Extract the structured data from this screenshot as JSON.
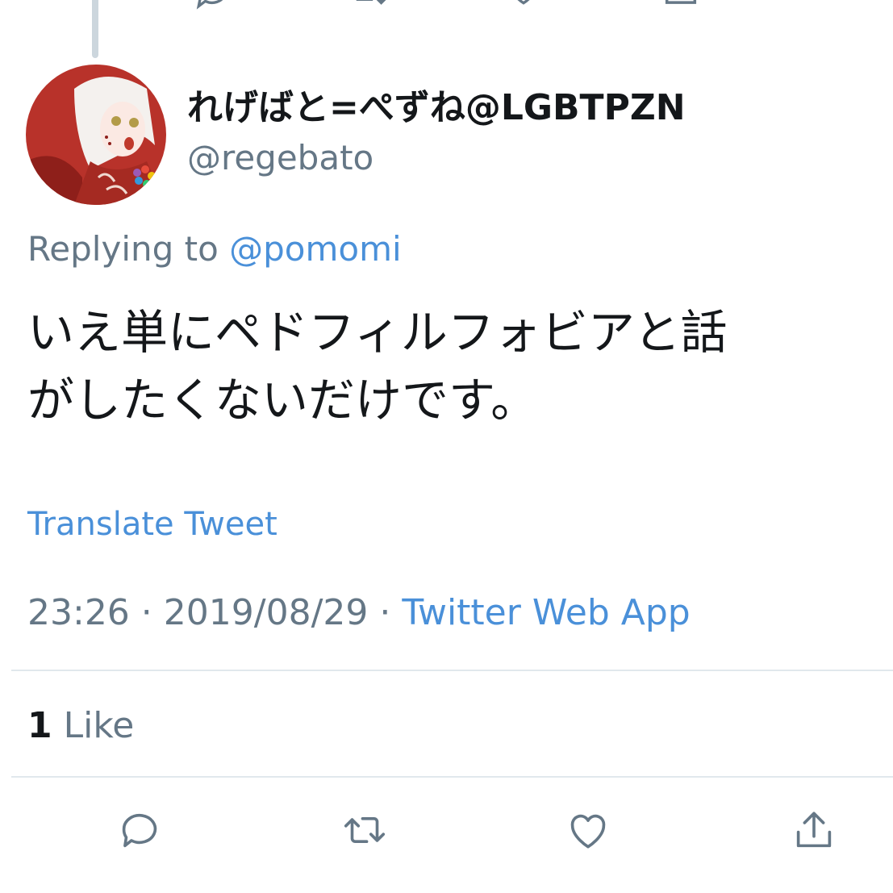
{
  "tweet": {
    "display_name": "れげばと=ぺずね@LGBTPZN",
    "handle": "@regebato",
    "replying_prefix": "Replying to ",
    "replying_to": "@pomomi",
    "text_line1": "いえ単にペドフィルフォビアと話",
    "text_line2": "がしたくないだけです。",
    "translate_label": "Translate Tweet",
    "time": "23:26",
    "date": "2019/08/29",
    "separator": " · ",
    "source": "Twitter Web App",
    "like_count": "1",
    "like_label": " Like"
  },
  "icons": {
    "top_actions": [
      "reply-icon",
      "retweet-icon",
      "like-icon",
      "share-icon"
    ],
    "bottom_actions": [
      "reply-icon",
      "retweet-icon",
      "like-icon",
      "share-icon"
    ]
  },
  "colors": {
    "link": "#4a90d9",
    "secondary_text": "#657786",
    "primary_text": "#14171a",
    "icon": "#657786",
    "divider": "#e1e8ed"
  }
}
